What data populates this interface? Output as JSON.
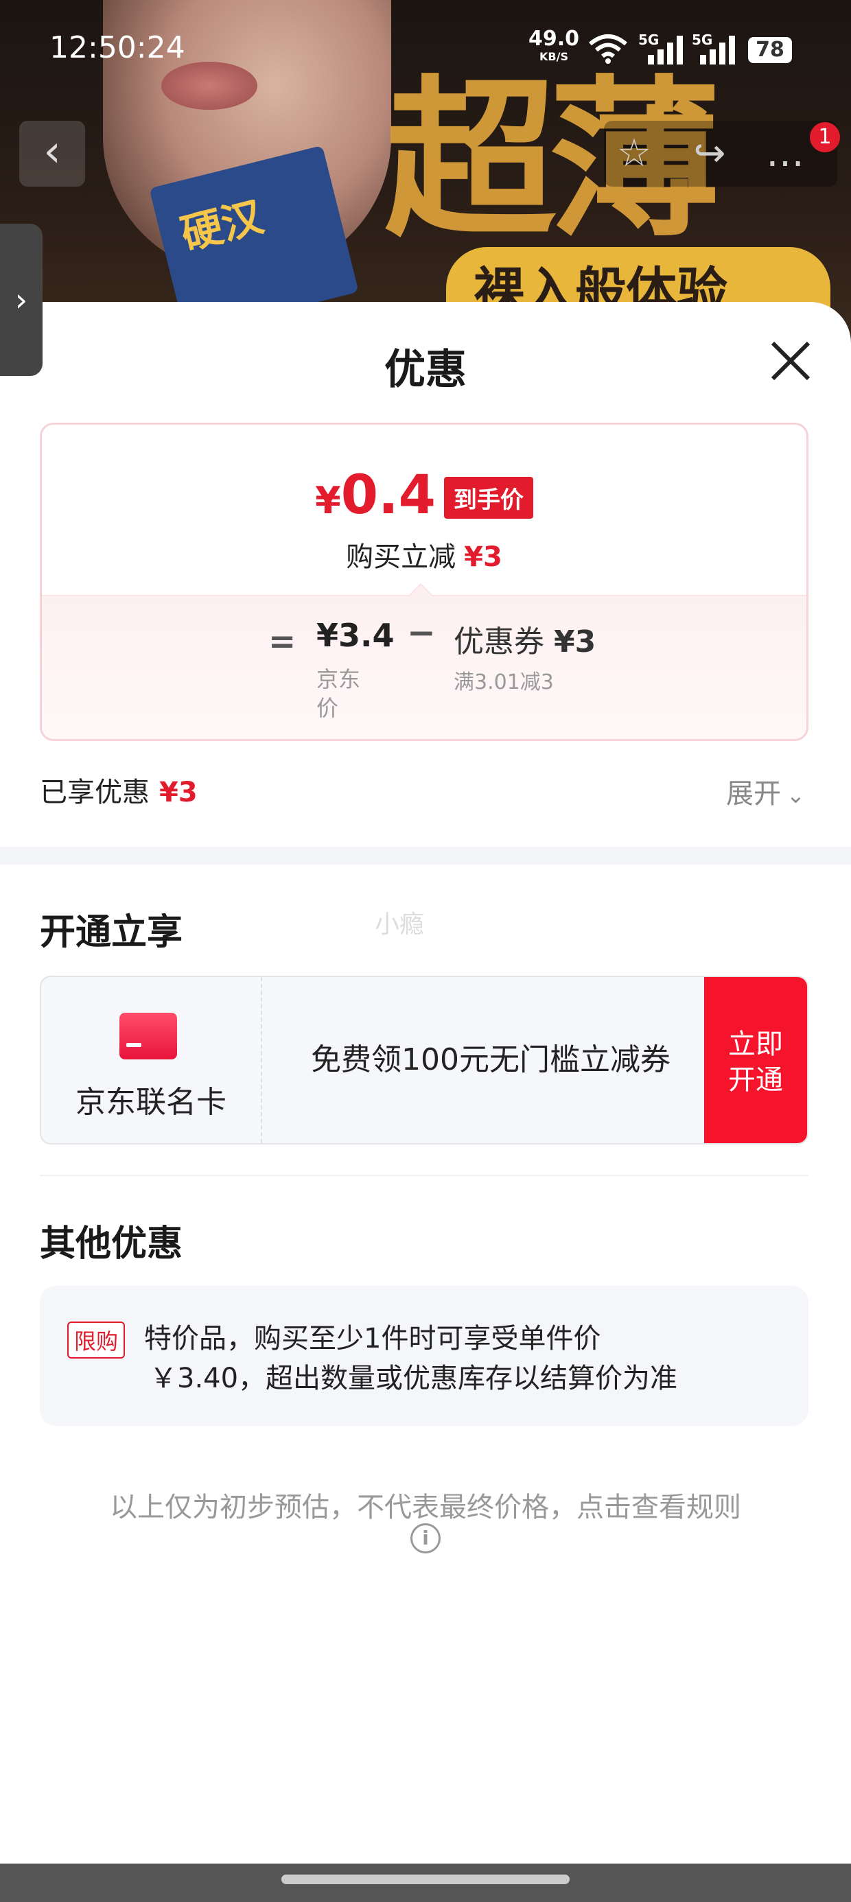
{
  "status_bar": {
    "time": "12:50:24",
    "net_speed": "49.0",
    "net_unit": "KB/S",
    "sig1": "5G",
    "sig2": "5G",
    "battery": "78"
  },
  "banner": {
    "promo_big": "超薄",
    "promo_sub": "裸入般体验",
    "product_mark": "硬汉",
    "badge_count": "1"
  },
  "sheet": {
    "title": "优惠"
  },
  "price_card": {
    "currency": "¥",
    "final_price": "0.4",
    "final_tag": "到手价",
    "discount_label": "购买立减",
    "discount_value": "¥3",
    "equals": "=",
    "jd_price": "¥3.4",
    "jd_label": "京东价",
    "minus": "−",
    "coupon_label": "优惠券",
    "coupon_value": "¥3",
    "coupon_condition": "满3.01减3"
  },
  "enjoyed": {
    "label": "已享优惠",
    "value": "¥3",
    "expand_label": "展开"
  },
  "open_section": {
    "title": "开通立享",
    "ghost_text": "小瘾",
    "card_name": "京东联名卡",
    "card_desc": "免费领100元无门槛立减券",
    "button_line1": "立即",
    "button_line2": "开通"
  },
  "other_section": {
    "title": "其他优惠",
    "tag": "限购",
    "line1": "特价品，购买至少1件时可享受单件价",
    "line2": "￥3.40，超出数量或优惠库存以结算价为准"
  },
  "footnote": "以上仅为初步预估，不代表最终价格，点击查看规则",
  "colors": {
    "accent_red": "#e31c2d",
    "button_red": "#f5142c"
  },
  "icons": [
    "back-icon",
    "star-icon",
    "share-icon",
    "more-icon",
    "side-expand-icon",
    "close-icon",
    "chevron-down-icon",
    "card-icon",
    "info-icon",
    "wifi-icon",
    "signal-icon"
  ]
}
